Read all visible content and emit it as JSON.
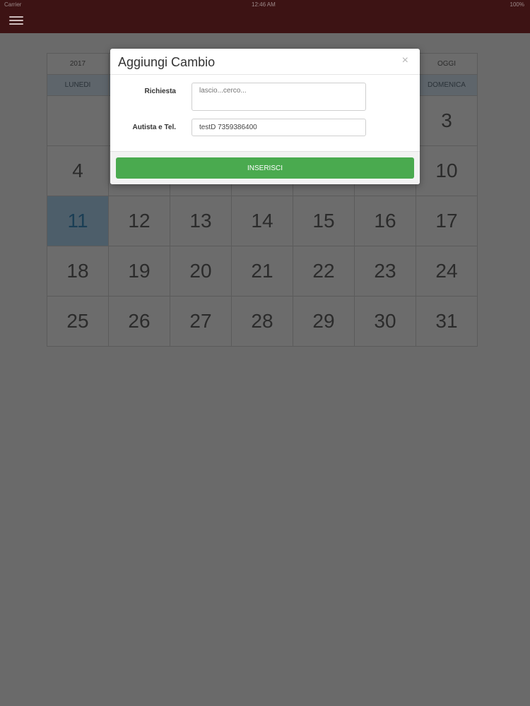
{
  "status_bar": {
    "carrier": "Carrier",
    "time": "12:46 AM",
    "battery": "100%"
  },
  "app_bar": {
    "menu_icon": "hamburger-menu-icon"
  },
  "calendar": {
    "year": "2017",
    "today_label": "OGGI",
    "weekdays": [
      "LUNEDI",
      "",
      "",
      "",
      "",
      "",
      "DOMENICA"
    ],
    "weeks": [
      [
        "",
        "",
        "",
        "",
        "",
        "",
        "3"
      ],
      [
        "4",
        "",
        "",
        "",
        "",
        "",
        "10"
      ],
      [
        "11",
        "12",
        "13",
        "14",
        "15",
        "16",
        "17"
      ],
      [
        "18",
        "19",
        "20",
        "21",
        "22",
        "23",
        "24"
      ],
      [
        "25",
        "26",
        "27",
        "28",
        "29",
        "30",
        "31"
      ]
    ],
    "highlight_day": "11"
  },
  "modal": {
    "title": "Aggiungi Cambio",
    "close_symbol": "×",
    "richiesta_label": "Richiesta",
    "richiesta_placeholder": "lascio...cerco...",
    "autista_label": "Autista e Tel.",
    "autista_value": "testD 7359386400",
    "submit_label": "INSERISCI"
  },
  "colors": {
    "app_bar": "#3d1314",
    "submit": "#4aaa4f",
    "overlay_bg": "#6a6a6a"
  }
}
